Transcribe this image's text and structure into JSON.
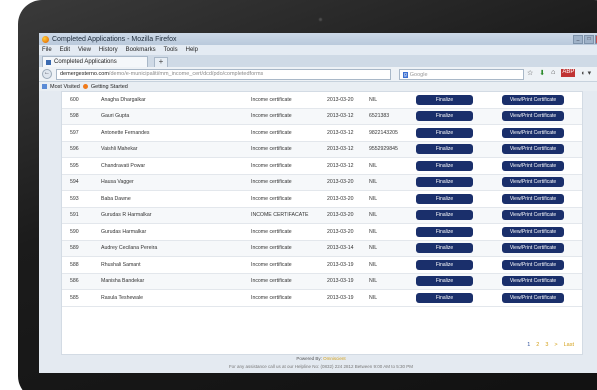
{
  "window": {
    "title": "Completed Applications - Mozilla Firefox",
    "controls": [
      "_",
      "□",
      "×"
    ]
  },
  "menu": [
    "File",
    "Edit",
    "View",
    "History",
    "Bookmarks",
    "Tools",
    "Help"
  ],
  "tab": {
    "label": "Completed Applications",
    "new_tab": "+"
  },
  "nav": {
    "back": "←",
    "url_host": "demergesterno.com",
    "url_path": "/demo/e-municipaliti/mm_income_cert/dcd/pdo/completedforms",
    "search_placeholder": "Google",
    "search_engine": "g"
  },
  "nav_icons": {
    "bookmark": "☆",
    "download": "⬇",
    "home": "⌂",
    "abp": "ABP",
    "extra": "◐ ▾"
  },
  "bookmarks": {
    "most_visited": "Most Visited",
    "getting_started": "Getting Started"
  },
  "buttons": {
    "finalize": "Finalize",
    "view": "View/Print Certificate"
  },
  "rows": [
    {
      "id": "600",
      "name": "Anagha Dhargalkar",
      "cert": "Income certificate",
      "date": "2013-03-20",
      "phone": "NIL"
    },
    {
      "id": "598",
      "name": "Gauri Gupta",
      "cert": "Income certificate",
      "date": "2013-03-12",
      "phone": "6521383"
    },
    {
      "id": "597",
      "name": "Antonette Fernandes",
      "cert": "Income certificate",
      "date": "2013-03-12",
      "phone": "9822143205"
    },
    {
      "id": "596",
      "name": "Vaishli Mahekar",
      "cert": "Income certificate",
      "date": "2013-03-12",
      "phone": "9552929845"
    },
    {
      "id": "595",
      "name": "Chandravati Powar",
      "cert": "Income certificate",
      "date": "2013-03-12",
      "phone": "NIL"
    },
    {
      "id": "594",
      "name": "Hausa Vagger",
      "cert": "Income certificate",
      "date": "2013-03-20",
      "phone": "NIL"
    },
    {
      "id": "593",
      "name": "Baba Dawne",
      "cert": "Income certificate",
      "date": "2013-03-20",
      "phone": "NIL"
    },
    {
      "id": "591",
      "name": "Gurudas R Harmalkar",
      "cert": "INCOME CERTIFACATE",
      "date": "2013-03-20",
      "phone": "NIL"
    },
    {
      "id": "590",
      "name": "Gurudas Harmalkar",
      "cert": "Income certificate",
      "date": "2013-03-20",
      "phone": "NIL"
    },
    {
      "id": "589",
      "name": "Audrey Cecilana Pereira",
      "cert": "Income certificate",
      "date": "2013-03-14",
      "phone": "NIL"
    },
    {
      "id": "588",
      "name": "Rhushali Samant",
      "cert": "Income certificate",
      "date": "2013-03-19",
      "phone": "NIL"
    },
    {
      "id": "586",
      "name": "Manisha Bandekar",
      "cert": "Income certificate",
      "date": "2013-03-19",
      "phone": "NIL"
    },
    {
      "id": "585",
      "name": "Rasula Teshewale",
      "cert": "Income certificate",
      "date": "2013-03-19",
      "phone": "NIL"
    }
  ],
  "pager": {
    "p1": "1",
    "p2": "2",
    "p3": "3",
    "next": ">",
    "last": "Last"
  },
  "footer": {
    "powered_label": "Powered By:",
    "powered_brand": "Omniscient",
    "contact": "For any assistance call us at our Helpline No: (0832) 224 2812 Between 9:00 AM to 5:30 PM"
  },
  "colors": {
    "button": "#1a2f6b",
    "bezel": "#1b1b1b",
    "brand": "#d4a11a"
  }
}
